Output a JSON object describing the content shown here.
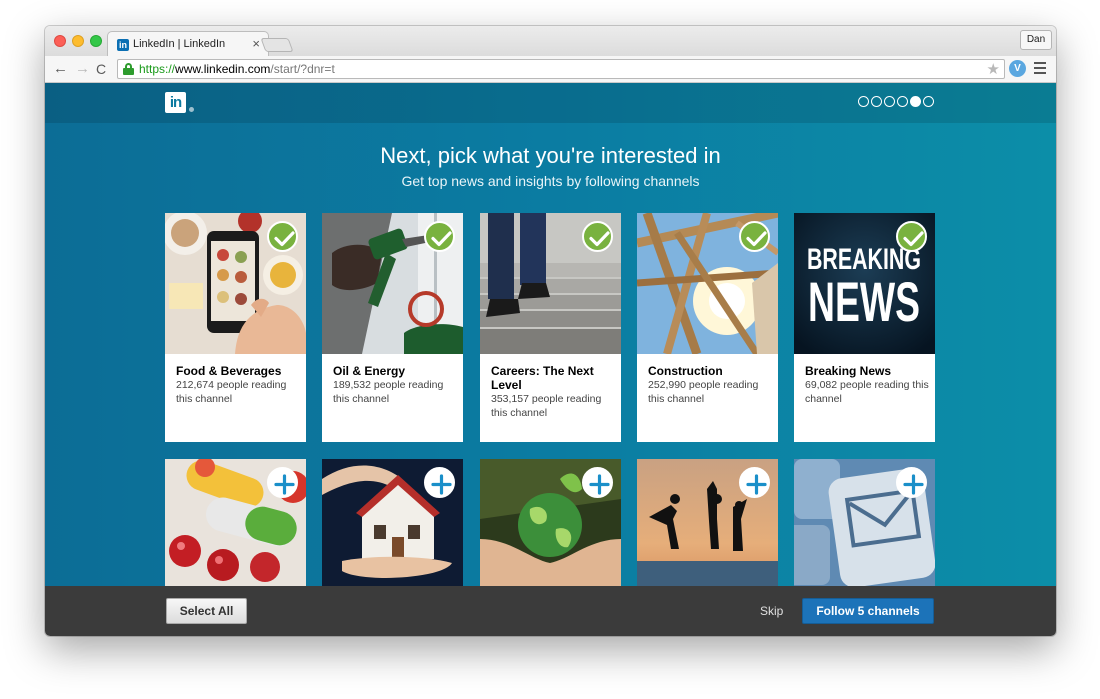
{
  "browser": {
    "tab_title": "LinkedIn | LinkedIn",
    "tab_close": "×",
    "favicon_text": "in",
    "profile_name": "Dan",
    "url_scheme": "https://",
    "url_host": "www.linkedin.com",
    "url_path": "/start/?dnr=t",
    "nav_back": "←",
    "nav_forward": "→",
    "nav_reload": "C",
    "star": "★",
    "ext_icon": "V"
  },
  "page": {
    "logo_text": "in",
    "headline": "Next, pick what you're interested in",
    "subline": "Get top news and insights by following channels",
    "step_dots": {
      "total": 6,
      "active_index": 4
    }
  },
  "channels_row1": [
    {
      "title": "Food & Beverages",
      "readers": "212,674 people reading this channel",
      "selected": true,
      "image": "food-phone-image"
    },
    {
      "title": "Oil & Energy",
      "readers": "189,532 people reading this channel",
      "selected": true,
      "image": "fuel-nozzle-image"
    },
    {
      "title": "Careers: The Next Level",
      "readers": "353,157 people reading this channel",
      "selected": true,
      "image": "stairs-shoes-image"
    },
    {
      "title": "Construction",
      "readers": "252,990 people reading this channel",
      "selected": true,
      "image": "timber-frame-image"
    },
    {
      "title": "Breaking News",
      "readers": "69,082 people reading this channel",
      "selected": true,
      "image": "breaking-news-image"
    }
  ],
  "channels_row2": [
    {
      "selected": false,
      "image": "pills-image"
    },
    {
      "selected": false,
      "image": "house-hands-image"
    },
    {
      "selected": false,
      "image": "globe-hands-image"
    },
    {
      "selected": false,
      "image": "beach-jump-image"
    },
    {
      "selected": false,
      "image": "email-key-image"
    }
  ],
  "breaking_news_line1": "BREAKING",
  "breaking_news_line2": "NEWS",
  "footer": {
    "select_all": "Select All",
    "skip": "Skip",
    "follow": "Follow 5 channels"
  },
  "colors": {
    "accent": "#1c73b9",
    "check_green": "#79b23f",
    "page_bg": "#0b7ca2"
  }
}
